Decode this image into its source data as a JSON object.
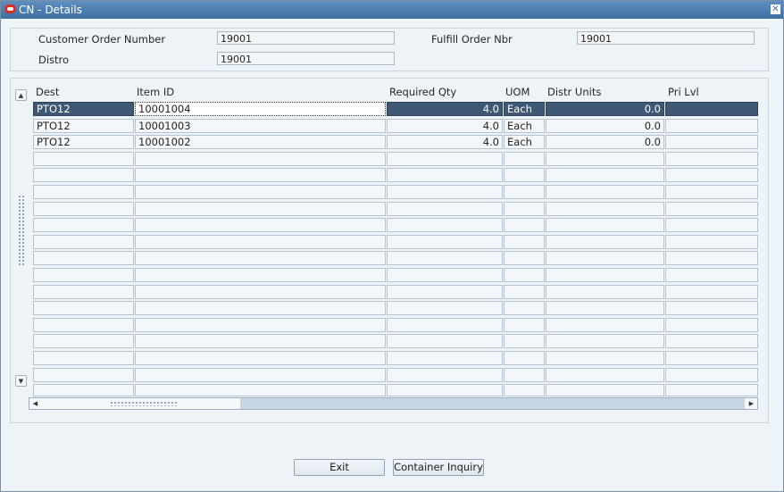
{
  "window": {
    "title": "CN - Details"
  },
  "form": {
    "customer_order_label": "Customer Order Number",
    "customer_order_value": "19001",
    "fulfill_order_label": "Fulfill Order Nbr",
    "fulfill_order_value": "19001",
    "distro_label": "Distro",
    "distro_value": "19001"
  },
  "table": {
    "columns": [
      "Dest",
      "Item ID",
      "Required Qty",
      "UOM",
      "Distr Units",
      "Pri Lvl"
    ],
    "rows": [
      [
        "PTO12",
        "10001004",
        "4.0",
        "Each",
        "0.0",
        ""
      ],
      [
        "PTO12",
        "10001003",
        "4.0",
        "Each",
        "0.0",
        ""
      ],
      [
        "PTO12",
        "10001002",
        "4.0",
        "Each",
        "0.0",
        ""
      ],
      [
        "",
        "",
        "",
        "",
        "",
        ""
      ],
      [
        "",
        "",
        "",
        "",
        "",
        ""
      ],
      [
        "",
        "",
        "",
        "",
        "",
        ""
      ],
      [
        "",
        "",
        "",
        "",
        "",
        ""
      ],
      [
        "",
        "",
        "",
        "",
        "",
        ""
      ],
      [
        "",
        "",
        "",
        "",
        "",
        ""
      ],
      [
        "",
        "",
        "",
        "",
        "",
        ""
      ],
      [
        "",
        "",
        "",
        "",
        "",
        ""
      ],
      [
        "",
        "",
        "",
        "",
        "",
        ""
      ],
      [
        "",
        "",
        "",
        "",
        "",
        ""
      ],
      [
        "",
        "",
        "",
        "",
        "",
        ""
      ],
      [
        "",
        "",
        "",
        "",
        "",
        ""
      ],
      [
        "",
        "",
        "",
        "",
        "",
        ""
      ],
      [
        "",
        "",
        "",
        "",
        "",
        ""
      ],
      [
        "",
        "",
        "",
        "",
        "",
        ""
      ]
    ],
    "selected_row": 0
  },
  "buttons": {
    "exit": "Exit",
    "container_inquiry": "Container Inquiry"
  }
}
